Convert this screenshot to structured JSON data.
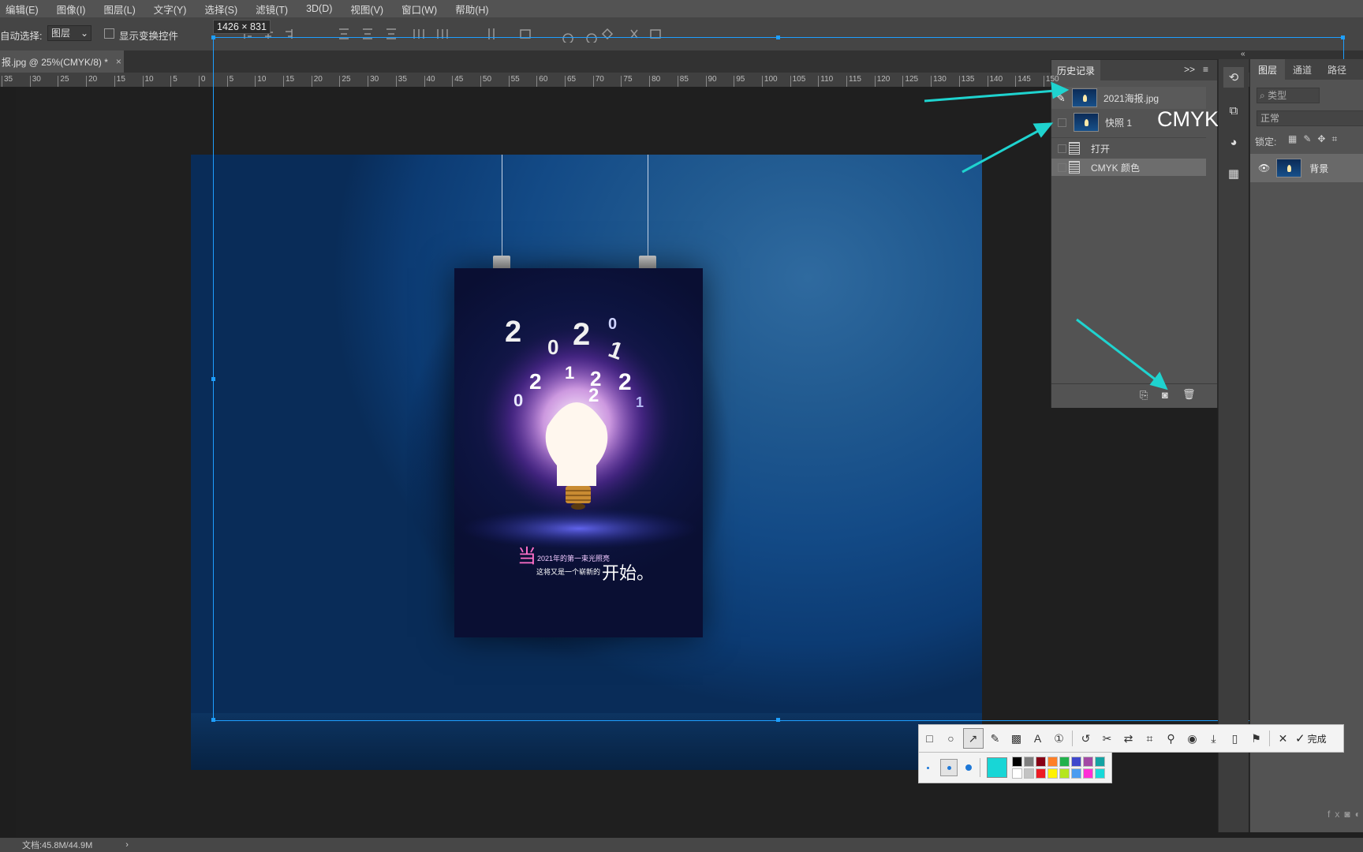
{
  "menu": {
    "items": [
      "编辑(E)",
      "图像(I)",
      "图层(L)",
      "文字(Y)",
      "选择(S)",
      "滤镜(T)",
      "3D(D)",
      "视图(V)",
      "窗口(W)",
      "帮助(H)"
    ]
  },
  "options": {
    "auto_select_label": "自动选择:",
    "auto_select_value": "图层",
    "show_transform_label": "显示变换控件"
  },
  "document": {
    "tab_label": "报.jpg @ 25%(CMYK/8) *",
    "tab_close": "×"
  },
  "ruler": {
    "ticks": [
      "35",
      "30",
      "25",
      "20",
      "15",
      "10",
      "5",
      "0",
      "5",
      "10",
      "15",
      "20",
      "25",
      "30",
      "35",
      "40",
      "45",
      "50",
      "55",
      "60",
      "65",
      "70",
      "75",
      "80",
      "85",
      "90",
      "95",
      "100",
      "105",
      "110",
      "115",
      "120",
      "125",
      "130",
      "135",
      "140",
      "145",
      "150"
    ]
  },
  "selection": {
    "size_label": "1426 × 831"
  },
  "poster": {
    "digits": [
      "2",
      "0",
      "2",
      "1",
      "0",
      "2",
      "1",
      "2",
      "0",
      "2",
      "2",
      "1"
    ],
    "line1_big": "当",
    "line1_small": "2021年的第一束光照亮",
    "line2_small": "这将又是一个崭新的",
    "line2_big": "开始。"
  },
  "history": {
    "tab_label": "历史记录",
    "expand": ">>",
    "source_label": "2021海报.jpg",
    "snapshot_label": "快照 1",
    "annotation_text": "CMYK",
    "steps": [
      "打开",
      "CMYK 颜色"
    ]
  },
  "layers": {
    "tabs": [
      "图层",
      "通道",
      "路径"
    ],
    "filter_placeholder": "类型",
    "blend_mode": "正常",
    "lock_label": "锁定:",
    "layer_name": "背景"
  },
  "status": {
    "doc_info": "文档:45.8M/44.9M",
    "chevron": "›"
  },
  "snip": {
    "done_label": "完成",
    "colors_row1": [
      "#000000",
      "#7f7f7f",
      "#880015",
      "#ff7f27",
      "#22b14c",
      "#3f48cc",
      "#a349a4",
      "#14a3a3"
    ],
    "colors_row2": [
      "#ffffff",
      "#c3c3c3",
      "#ed1c24",
      "#fff200",
      "#b5e61d",
      "#4a9cf0",
      "#ff2fd6",
      "#18d9d9"
    ],
    "current_color": "#18d6d6"
  },
  "colors": {
    "accent": "#1e9fff",
    "arrow": "#1fd3cf"
  }
}
